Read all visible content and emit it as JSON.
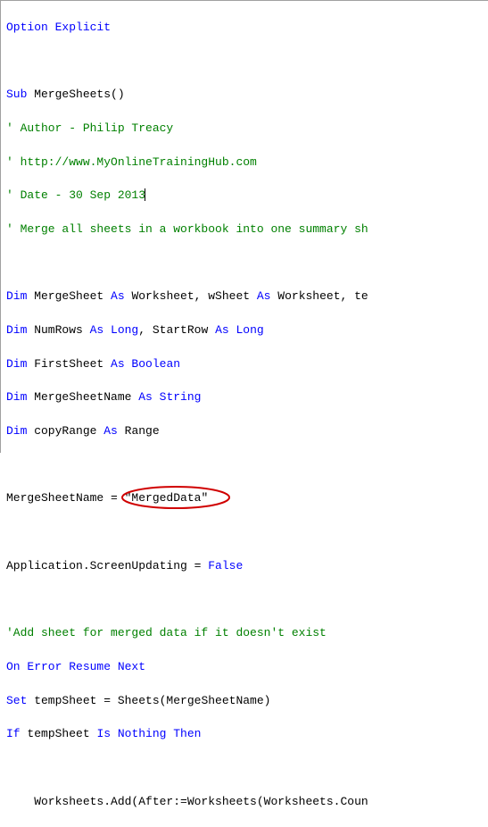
{
  "lines": {
    "l1_kw": "Option Explicit",
    "l3_kw": "Sub",
    "l3_t": " MergeSheets()",
    "l4": "' Author - Philip Treacy",
    "l5": "' http://www.MyOnlineTrainingHub.com",
    "l6": "' Date - 30 Sep 2013",
    "l7": "' Merge all sheets in a workbook into one summary sh",
    "l9_a": "Dim",
    "l9_b": " MergeSheet ",
    "l9_c": "As",
    "l9_d": " Worksheet, wSheet ",
    "l9_e": "As",
    "l9_f": " Worksheet, te",
    "l10_a": "Dim",
    "l10_b": " NumRows ",
    "l10_c": "As Long",
    "l10_d": ", StartRow ",
    "l10_e": "As Long",
    "l11_a": "Dim",
    "l11_b": " FirstSheet ",
    "l11_c": "As Boolean",
    "l12_a": "Dim",
    "l12_b": " MergeSheetName ",
    "l12_c": "As String",
    "l13_a": "Dim",
    "l13_b": " copyRange ",
    "l13_c": "As",
    "l13_d": " Range",
    "l15_a": "MergeSheetName = ",
    "l15_b": "\"MergedData\"",
    "l17_a": "Application.ScreenUpdating = ",
    "l17_b": "False",
    "l19": "'Add sheet for merged data if it doesn't exist",
    "l20": "On Error Resume Next",
    "l21_a": "Set",
    "l21_b": " tempSheet = Sheets(MergeSheetName)",
    "l22_a": "If",
    "l22_b": " tempSheet ",
    "l22_c": "Is Nothing Then",
    "l24": "    Worksheets.Add(After:=Worksheets(Worksheets.Coun"
  }
}
